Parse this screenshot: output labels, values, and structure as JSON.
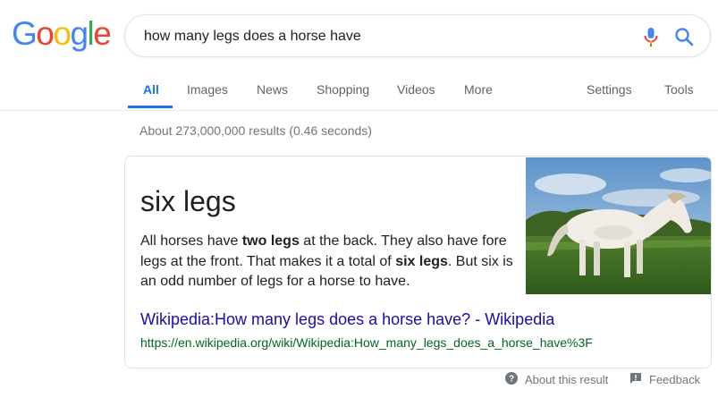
{
  "logo": {
    "letters": [
      {
        "char": "G",
        "color": "#4285F4"
      },
      {
        "char": "o",
        "color": "#EA4335"
      },
      {
        "char": "o",
        "color": "#FBBC05"
      },
      {
        "char": "g",
        "color": "#4285F4"
      },
      {
        "char": "l",
        "color": "#34A853"
      },
      {
        "char": "e",
        "color": "#EA4335"
      }
    ]
  },
  "search": {
    "query": "how many legs does a horse have"
  },
  "tabs": [
    {
      "label": "All",
      "active": true
    },
    {
      "label": "Images"
    },
    {
      "label": "News"
    },
    {
      "label": "Shopping"
    },
    {
      "label": "Videos"
    },
    {
      "label": "More"
    }
  ],
  "tools": {
    "settings": "Settings",
    "tools": "Tools"
  },
  "stats": "About 273,000,000 results (0.46 seconds)",
  "answer": {
    "heading": "six legs",
    "snippet": [
      {
        "text": "All horses have ",
        "bold": false
      },
      {
        "text": "two legs",
        "bold": true
      },
      {
        "text": " at the back. They also have fore legs at the front. That makes it a total of ",
        "bold": false
      },
      {
        "text": "six legs",
        "bold": true
      },
      {
        "text": ". But six is an odd number of legs for a horse to have.",
        "bold": false
      }
    ],
    "link_title": "Wikipedia:How many legs does a horse have? - Wikipedia",
    "url": "https://en.wikipedia.org/wiki/Wikipedia:How_many_legs_does_a_horse_have%3F"
  },
  "footer": {
    "about": "About this result",
    "feedback": "Feedback"
  },
  "colors": {
    "accent": "#1a73e8",
    "link": "#1a0dab",
    "url": "#006621"
  }
}
